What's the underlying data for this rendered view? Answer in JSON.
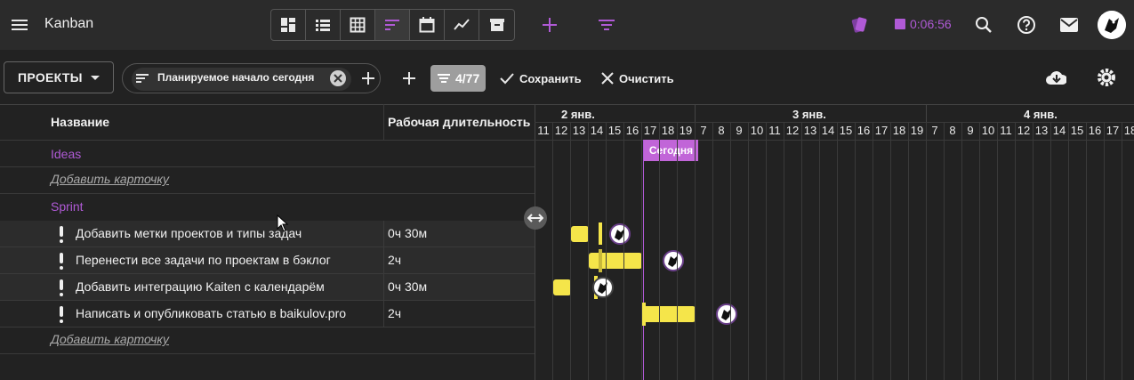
{
  "app": {
    "title": "Kanban",
    "accent_color": "#b05ad6",
    "bar_color": "#f5e54a"
  },
  "toolbar": {
    "views": [
      "board-view-icon",
      "list-view-icon",
      "table-view-icon",
      "gantt-view-icon",
      "calendar-view-icon",
      "chart-view-icon",
      "archive-view-icon"
    ],
    "active_view": "gantt-view-icon",
    "timer": "0:06:56"
  },
  "filters": {
    "projects_label": "ПРОЕКТЫ",
    "active_filter": "Планируемое начало сегодня",
    "count": "4/77",
    "save_label": "Сохранить",
    "clear_label": "Очистить"
  },
  "table": {
    "col_name": "Название",
    "col_duration": "Рабочая длительность",
    "add_card_label": "Добавить карточку",
    "groups": [
      {
        "name": "Ideas",
        "tasks": []
      },
      {
        "name": "Sprint",
        "tasks": [
          {
            "name": "Добавить метки проектов и типы задач",
            "duration": "0ч 30м"
          },
          {
            "name": "Перенести все задачи по проектам в бэклог",
            "duration": "2ч"
          },
          {
            "name": "Добавить интеграцию Kaiten с календарём",
            "duration": "0ч 30м"
          },
          {
            "name": "Написать и опубликовать статью в baikulov.pro",
            "duration": "2ч"
          }
        ]
      }
    ]
  },
  "gantt": {
    "days": [
      "2 янв.",
      "3 янв.",
      "4 янв."
    ],
    "hours": [
      "11",
      "12",
      "13",
      "14",
      "15",
      "16",
      "17",
      "18",
      "19",
      "7",
      "8",
      "9",
      "10",
      "11",
      "12",
      "13",
      "14",
      "15",
      "16",
      "17",
      "18",
      "19",
      "7",
      "8",
      "9",
      "10",
      "11",
      "12",
      "13",
      "14",
      "15",
      "16",
      "17",
      "18"
    ],
    "today_label": "Сегодня"
  }
}
